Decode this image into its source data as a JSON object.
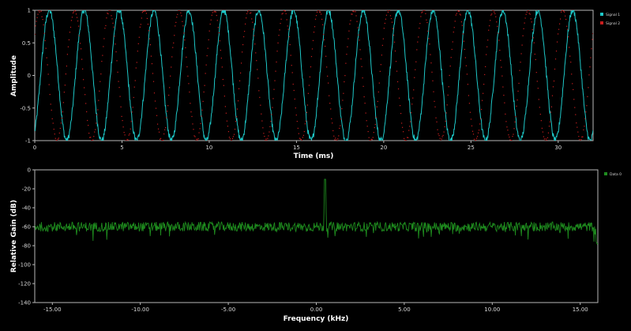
{
  "colors": {
    "background": "#000000",
    "frame": "#b8b8b8",
    "signal1": "#1ec8c8",
    "signal2": "#c81e1e",
    "data0": "#1e8c1e"
  },
  "chart_data": [
    {
      "type": "line",
      "xlabel": "Time (ms)",
      "ylabel": "Amplitude",
      "xlim": [
        0,
        32
      ],
      "ylim": [
        -1,
        1
      ],
      "xticks": [
        "0",
        "5",
        "10",
        "15",
        "20",
        "25",
        "30"
      ],
      "yticks": [
        "1",
        "0.5",
        "0",
        "-0.5",
        "-1"
      ],
      "grid": false,
      "legend_position": "top-right",
      "series": [
        {
          "name": "Signal 1",
          "style": "line",
          "color": "#1ec8c8",
          "frequency_khz": 0.5,
          "amplitude": 1,
          "phase_deg": -60,
          "noise": 0.05
        },
        {
          "name": "Signal 2",
          "style": "dotted",
          "color": "#c81e1e",
          "frequency_khz": 0.5,
          "amplitude": 1,
          "phase_deg": 40,
          "noise": 0.03
        }
      ]
    },
    {
      "type": "line",
      "xlabel": "Frequency (kHz)",
      "ylabel": "Relative Gain (dB)",
      "xlim": [
        -16,
        16
      ],
      "ylim": [
        -140,
        0
      ],
      "xticks": [
        "-15.00",
        "-10.00",
        "-5.00",
        "0.00",
        "5.00",
        "10.00",
        "15.00"
      ],
      "yticks": [
        "0",
        "-20",
        "-40",
        "-60",
        "-80",
        "-100",
        "-120",
        "-140"
      ],
      "grid": false,
      "legend_position": "top-right",
      "series": [
        {
          "name": "Data 0",
          "color": "#1e8c1e",
          "noise_floor_db": -60,
          "peak_frequency_khz": 0.5,
          "peak_db": -10
        }
      ]
    }
  ]
}
